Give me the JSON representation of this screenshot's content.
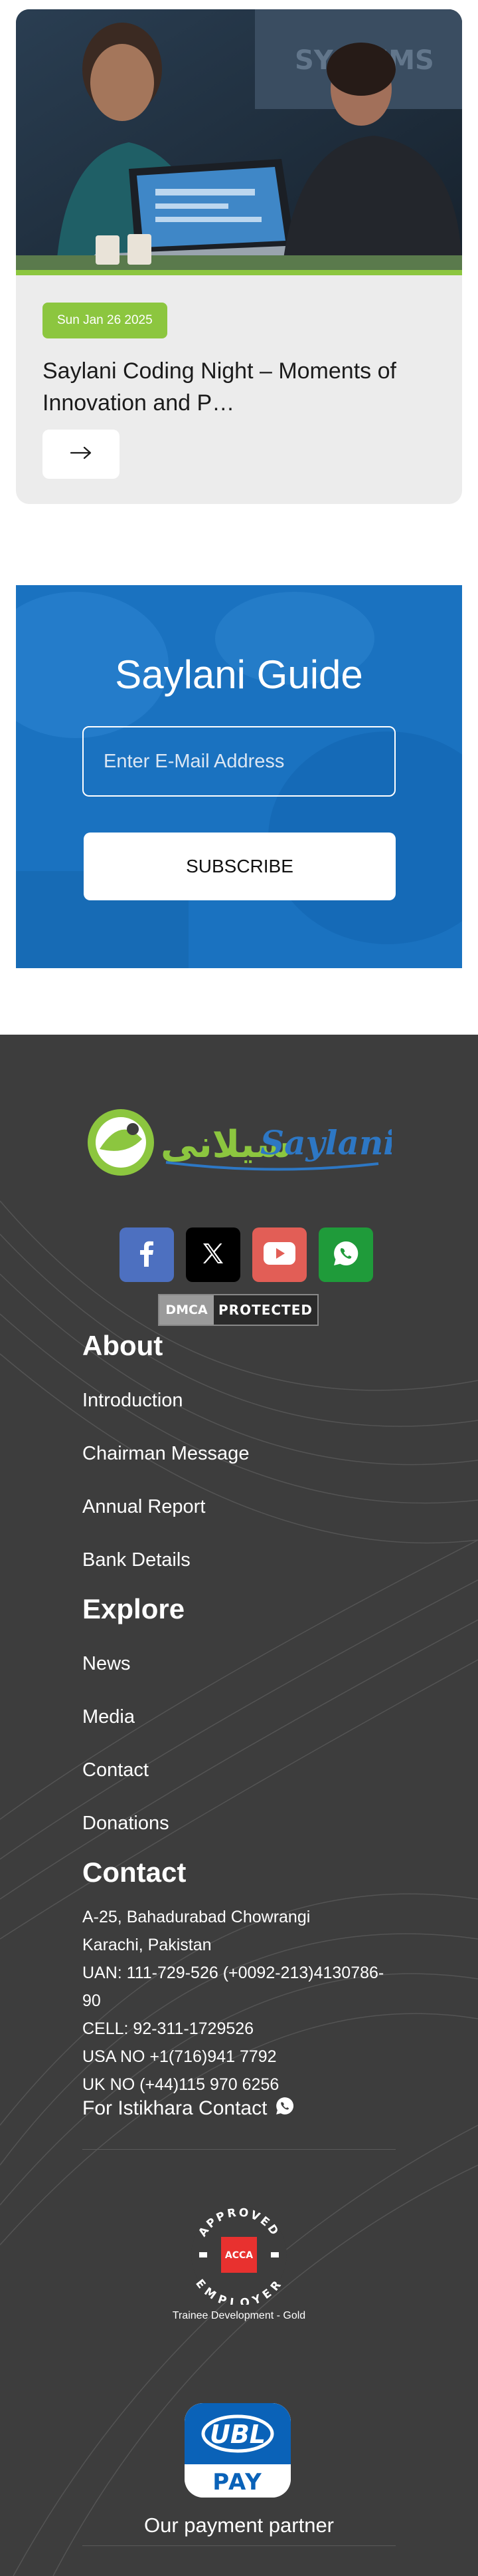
{
  "card": {
    "date": "Sun Jan 26 2025",
    "title": "Saylani Coding Night – Moments of Innovation and P…",
    "arrow_icon": "arrow-right-icon"
  },
  "guide": {
    "title": "Saylani Guide",
    "email_placeholder": "Enter E-Mail Address",
    "subscribe_label": "SUBSCRIBE",
    "bg_color": "#1874c4"
  },
  "footer": {
    "logo_text": "Saylani",
    "logo_urdu": "سیلانی",
    "social": [
      {
        "name": "facebook-icon",
        "color": "#4267b2"
      },
      {
        "name": "x-icon",
        "color": "#000000"
      },
      {
        "name": "youtube-icon",
        "color": "#e05d55"
      },
      {
        "name": "whatsapp-icon",
        "color": "#1f9b3a"
      }
    ],
    "dmca": {
      "left": "DMCA",
      "right": "PROTECTED"
    },
    "about": {
      "heading": "About",
      "links": [
        "Introduction",
        "Chairman Message",
        "Annual Report",
        "Bank Details"
      ]
    },
    "explore": {
      "heading": "Explore",
      "links": [
        "News",
        "Media",
        "Contact",
        "Donations"
      ]
    },
    "contact": {
      "heading": "Contact",
      "address_line1": "A-25, Bahadurabad Chowrangi",
      "address_line2": "Karachi, Pakistan",
      "uan_line1": "UAN: 111-729-526 (+0092-213)4130786-",
      "uan_line2": "90",
      "cell": "CELL: 92-311-1729526",
      "usa": "USA NO +1(716)941 7792",
      "uk": "UK NO (+44)115 970 6256",
      "istikhara": "For Istikhara Contact"
    },
    "acca": {
      "badge_top": "APPROVED",
      "badge_bottom": "EMPLOYER",
      "badge_center": "ACCA",
      "caption": "Trainee Development - Gold"
    },
    "ubl": {
      "top": "UBL",
      "bottom": "PAY"
    },
    "partner_text": "Our payment partner"
  }
}
